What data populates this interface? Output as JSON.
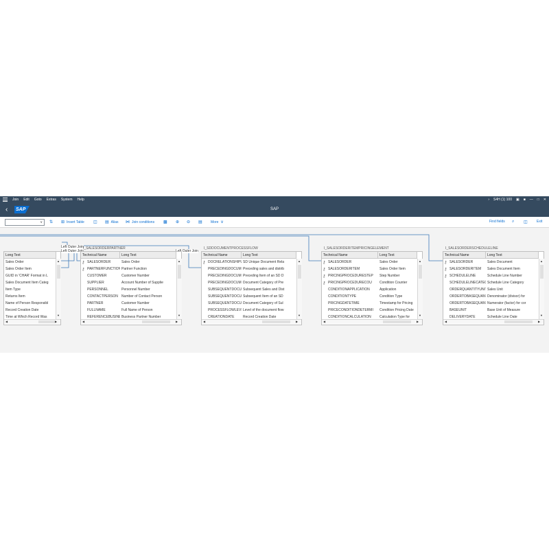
{
  "menubar": {
    "items": [
      "Join",
      "Edit",
      "Goto",
      "Extras",
      "System",
      "Help"
    ],
    "system_info": "S4H (1) 100"
  },
  "titlebar": {
    "logo": "SAP",
    "title": "SAP"
  },
  "toolbar": {
    "insert_table": "Insert Table",
    "alias": "Alias",
    "join_conditions": "Join conditions",
    "more": "More",
    "find_fields": "Find fields",
    "exit": "Exit"
  },
  "join_labels": {
    "left_outer_join": "Left Outer Join"
  },
  "tables": [
    {
      "name": "",
      "col_headers": [
        "Long Text"
      ],
      "rows": [
        [
          "Sales Order"
        ],
        [
          "Sales Order Item"
        ],
        [
          "GUID in 'CHAR' Format in L"
        ],
        [
          "Sales Document Item Categ"
        ],
        [
          "Item Type"
        ],
        [
          "Returns Item"
        ],
        [
          "Name of Person Responsibl"
        ],
        [
          "Record Creation Date"
        ],
        [
          "Time at Which Record Was"
        ]
      ]
    },
    {
      "name": "I_SALESORDERPARTNER",
      "col_headers": [
        "Technical Name",
        "Long Text"
      ],
      "rows": [
        [
          "SALESORDER",
          "Sales Order"
        ],
        [
          "PARTNERFUNCTION",
          "Partner Function"
        ],
        [
          "CUSTOMER",
          "Customer Number"
        ],
        [
          "SUPPLIER",
          "Account Number of Supplie"
        ],
        [
          "PERSONNEL",
          "Personnel Number"
        ],
        [
          "CONTACTPERSON",
          "Number of Contact Person"
        ],
        [
          "PARTNER",
          "Customer Number"
        ],
        [
          "FULLNAME",
          "Full Name of Person"
        ],
        [
          "REFERENCEBUSINE",
          "Business Partner Number"
        ]
      ]
    },
    {
      "name": "I_SDDOCUMENTPROCESSFLOW",
      "col_headers": [
        "Technical Name",
        "Long Text"
      ],
      "rows": [
        [
          "DOCRELATIONSHIPU",
          "SD Unique Document Rela"
        ],
        [
          "PRECEDINGDOCUME",
          "Preceding sales and distrib"
        ],
        [
          "PRECEDINGDOCUME",
          "Preceding Item of an SD D"
        ],
        [
          "PRECEDINGDOCUME",
          "Document Category of Pre"
        ],
        [
          "SUBSEQUENTDOCU",
          "Subsequent Sales and Dist"
        ],
        [
          "SUBSEQUENTDOCU",
          "Subsequent Item of an SD"
        ],
        [
          "SUBSEQUENTDOCU",
          "Document Category of Sul"
        ],
        [
          "PROCESSFLOWLEVE",
          "Level of the document flow"
        ],
        [
          "CREATIONDATE",
          "Record Creation Date"
        ]
      ]
    },
    {
      "name": "I_SALESORDERITEMPRICINGELEMENT",
      "col_headers": [
        "Technical Name",
        "Long Text"
      ],
      "rows": [
        [
          "SALESORDER",
          "Sales Order"
        ],
        [
          "SALESORDERITEM",
          "Sales Order Item"
        ],
        [
          "PRICINGPROCEDURESTEP",
          "Step Number"
        ],
        [
          "PRICINGPROCEDURECOU",
          "Condition Counter"
        ],
        [
          "CONDITIONAPPLICATION",
          "Application"
        ],
        [
          "CONDITIONTYPE",
          "Condition Type"
        ],
        [
          "PRICINGDATETIME",
          "Timestamp for Pricing"
        ],
        [
          "PRICECONDITIONDETERMI",
          "Condition Pricing Date"
        ],
        [
          "CONDITIONCALCULATION",
          "Calculation Type for"
        ]
      ]
    },
    {
      "name": "I_SALESORDERSCHEDULELINE",
      "col_headers": [
        "Technical Name",
        "Long Text"
      ],
      "rows": [
        [
          "SALESORDER",
          "Sales Document"
        ],
        [
          "SALESORDERITEM",
          "Sales Document Item"
        ],
        [
          "SCHEDULELINE",
          "Schedule Line Number"
        ],
        [
          "SCHEDULELINECATEG",
          "Schedule Line Category"
        ],
        [
          "ORDERQUANTITYUNIT",
          "Sales Unit"
        ],
        [
          "ORDERTOBASEQUANT",
          "Denominator (divisor) for"
        ],
        [
          "ORDERTOBASEQUANT",
          "Numerator (factor) for cor"
        ],
        [
          "BASEUNIT",
          "Base Unit of Measure"
        ],
        [
          "DELIVERYDATE",
          "Schedule Line Date"
        ]
      ]
    }
  ]
}
